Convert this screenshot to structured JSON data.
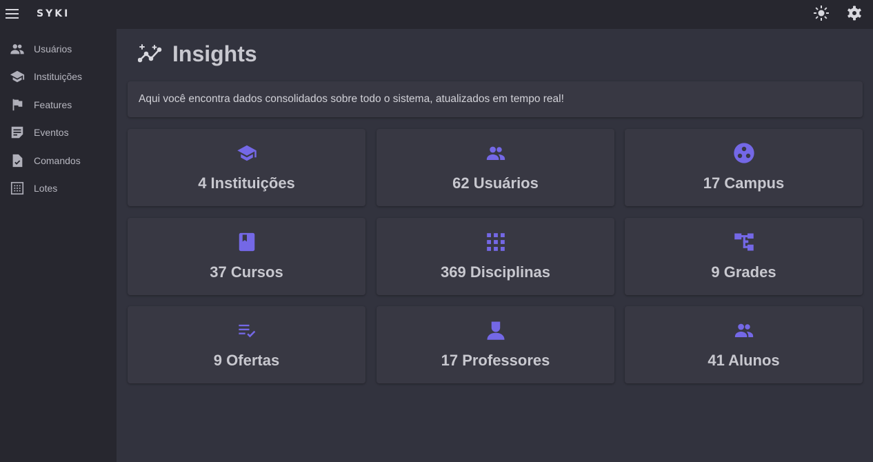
{
  "appbar": {
    "brand": "SYKI",
    "menu_icon": "menu-icon",
    "theme_icon": "sun-icon",
    "settings_icon": "gear-icon"
  },
  "sidebar": {
    "items": [
      {
        "label": "Usuários",
        "icon": "people-icon"
      },
      {
        "label": "Instituições",
        "icon": "graduation-cap-icon"
      },
      {
        "label": "Features",
        "icon": "flag-icon"
      },
      {
        "label": "Eventos",
        "icon": "note-icon"
      },
      {
        "label": "Comandos",
        "icon": "file-check-icon"
      },
      {
        "label": "Lotes",
        "icon": "grid-dots-icon"
      }
    ]
  },
  "main": {
    "title": "Insights",
    "title_icon": "insights-icon",
    "description": "Aqui você encontra dados consolidados sobre todo o sistema, atualizados em tempo real!",
    "accent_color": "#7468e6",
    "cards": [
      {
        "label": "4 Instituições",
        "icon": "graduation-cap-icon"
      },
      {
        "label": "62 Usuários",
        "icon": "people-icon"
      },
      {
        "label": "17 Campus",
        "icon": "circle-dots-icon"
      },
      {
        "label": "37 Cursos",
        "icon": "book-icon"
      },
      {
        "label": "369 Disciplinas",
        "icon": "apps-grid-icon"
      },
      {
        "label": "9 Grades",
        "icon": "account-tree-icon"
      },
      {
        "label": "9 Ofertas",
        "icon": "playlist-check-icon"
      },
      {
        "label": "17 Professores",
        "icon": "person-icon"
      },
      {
        "label": "41 Alunos",
        "icon": "people-icon"
      }
    ]
  }
}
